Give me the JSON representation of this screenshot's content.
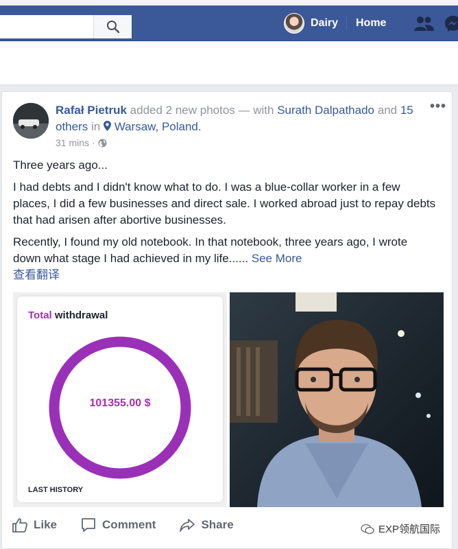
{
  "header": {
    "search_placeholder": "",
    "profile_name": "Dairy",
    "home_label": "Home",
    "icons": [
      "search-icon",
      "friends-icon",
      "messenger-icon"
    ]
  },
  "post": {
    "author": "Rafał Pietruk",
    "action_text": "added 2 new photos — with",
    "tagged": "Surath Dalpathado",
    "and": "and",
    "others": "15 others",
    "in": "in",
    "location": "Warsaw, Poland.",
    "time": "31 mins",
    "separator": "·",
    "paragraphs": [
      "Three years ago...",
      "I had debts and I didn't know what to do. I was a blue-collar worker in a few places, I did a few businesses and direct sale. I worked abroad just to repay debts that had arisen after abortive businesses.",
      "Recently, I found my old notebook. In that notebook, three years ago, I wrote down what stage I had achieved in my life......"
    ],
    "see_more": "See More",
    "translate": "查看翻译"
  },
  "withdrawal": {
    "title_accent": "Total",
    "title_rest": "withdrawal",
    "amount": "101355.00 $",
    "history_label": "LAST HISTORY",
    "ring_color": "#9b30b8"
  },
  "actions": {
    "like": "Like",
    "comment": "Comment",
    "share": "Share"
  },
  "watermark": {
    "text": "EXP领航国际"
  },
  "colors": {
    "brand_blue": "#3b5998",
    "link_blue": "#365899",
    "muted": "#90949c"
  }
}
